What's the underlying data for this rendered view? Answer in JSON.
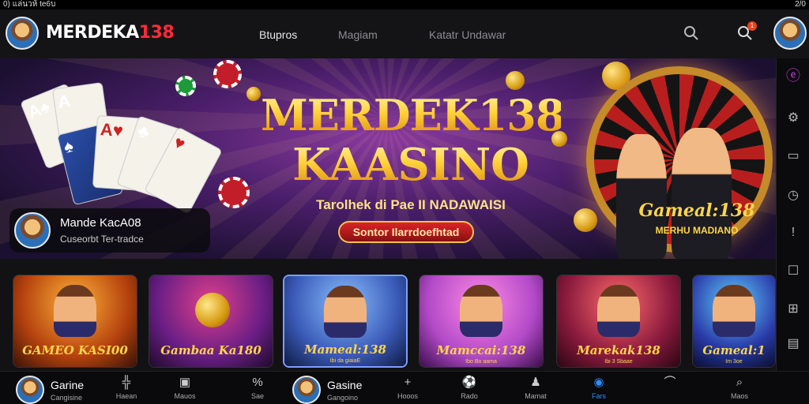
{
  "status_bar": {
    "left": "0) แล่นวห้ te6บ",
    "right": "2/0"
  },
  "header": {
    "brand_prefix": "MERDEKA",
    "brand_suffix": "138",
    "nav": [
      "Btupros",
      "Magiam",
      "Katatr Undawar"
    ],
    "notification_count": "1"
  },
  "banner": {
    "title_line1": "MERDEK138",
    "title_line2": "KAASINO",
    "subtitle": "Tarolhek di Pae II NADAWAISI",
    "cta_label": "Sontor Ilarrdoefhtad",
    "promo_title": "Mande KacA08",
    "promo_subtitle": "Cuseorbt Ter-tradce",
    "right_badge_title": "Gameal:138",
    "right_badge_sub": "MERHU MADIANO"
  },
  "games": [
    {
      "label": "GAMEO KASI00",
      "sub": "",
      "bg": "#b5420e"
    },
    {
      "label": "Gambaa Ka180",
      "sub": "",
      "bg": "#6a1e86"
    },
    {
      "label": "Mameal:138",
      "sub": "Ibi da giaiaE",
      "bg": "#3a5ab8"
    },
    {
      "label": "Mamccai:138",
      "sub": "Ibo Bo aama",
      "bg": "#b24ac8"
    },
    {
      "label": "Marekak138",
      "sub": "Ibi 3 Sbaae",
      "bg": "#8a1a3e"
    },
    {
      "label": "Gameal:1",
      "sub": "Im 3oe",
      "bg": "#2a3aa8"
    }
  ],
  "bottom_bar": {
    "profile1": {
      "title": "Garine",
      "sub": "Cangisine"
    },
    "profile2": {
      "title": "Gasine",
      "sub": "Gangoino"
    },
    "items": [
      {
        "label": "Haean",
        "icon": "chart-icon"
      },
      {
        "label": "Mauos",
        "icon": "square-icon"
      },
      {
        "label": "Sae",
        "icon": "sale-icon"
      },
      {
        "label": "Hooos",
        "icon": "plus-icon"
      },
      {
        "label": "Rado",
        "icon": "soccer-icon"
      },
      {
        "label": "Mamat",
        "icon": "person-icon"
      },
      {
        "label": "Fars",
        "icon": "circle-icon"
      },
      {
        "label": "",
        "icon": "tag-icon"
      },
      {
        "label": "Maos",
        "icon": "search-icon"
      }
    ]
  }
}
